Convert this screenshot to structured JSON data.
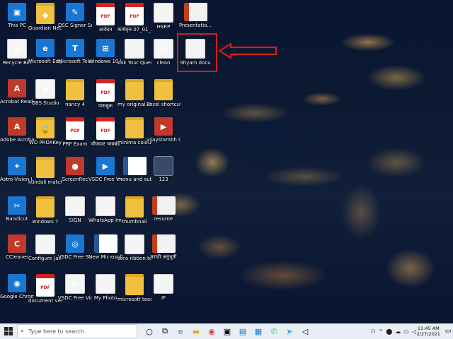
{
  "desktop": {
    "icons": [
      {
        "label": "This PC",
        "icon": "computer-icon",
        "style": "blue",
        "glyph": "▣"
      },
      {
        "label": "Guardian NetSecure",
        "icon": "guardian-shield-icon",
        "style": "folder",
        "glyph": "◆"
      },
      {
        "label": "DSC Signer Service",
        "icon": "dsc-signer-icon",
        "style": "blue",
        "glyph": "✎"
      },
      {
        "label": "आवेदन",
        "icon": "pdf-file-icon",
        "style": "pdf",
        "glyph": "PDF"
      },
      {
        "label": "कार्यवृत्त 07_01_2021",
        "icon": "pdf-file-icon",
        "style": "pdf",
        "glyph": "PDF"
      },
      {
        "label": "HSRP",
        "icon": "document-icon",
        "style": "doc",
        "glyph": ""
      },
      {
        "label": "Presentatio...",
        "icon": "powerpoint-file-icon",
        "style": "ppt",
        "glyph": ""
      },
      {
        "label": "Recycle Bin",
        "icon": "recycle-bin-icon",
        "style": "doc",
        "glyph": "♻"
      },
      {
        "label": "Microsoft Edge",
        "icon": "edge-browser-icon",
        "style": "blue",
        "glyph": "e"
      },
      {
        "label": "Microsoft Teams",
        "icon": "teams-icon",
        "style": "blue",
        "glyph": "T"
      },
      {
        "label": "Windows 10 Update As...",
        "icon": "windows-update-icon",
        "style": "blue",
        "glyph": "⊞"
      },
      {
        "label": "Ask Your Question",
        "icon": "document-icon",
        "style": "doc",
        "glyph": ""
      },
      {
        "label": "clean",
        "icon": "settings-file-icon",
        "style": "doc",
        "glyph": "⚙"
      },
      {
        "label": "Shyam docu",
        "icon": "word-file-icon",
        "style": "doc",
        "glyph": ""
      },
      {
        "label": "Acrobat Reader DC",
        "icon": "acrobat-icon",
        "style": "red",
        "glyph": "A"
      },
      {
        "label": "OBS Studio",
        "icon": "obs-studio-icon",
        "style": "doc",
        "glyph": "◉"
      },
      {
        "label": "nancy 4",
        "icon": "photo-file-icon",
        "style": "folder",
        "glyph": ""
      },
      {
        "label": "पासबुक",
        "icon": "pdf-file-icon",
        "style": "pdf",
        "glyph": "PDF"
      },
      {
        "label": "my original theme",
        "icon": "folder-icon",
        "style": "folder",
        "glyph": ""
      },
      {
        "label": "Excel shortcut...",
        "icon": "folder-icon",
        "style": "folder",
        "glyph": ""
      },
      {
        "label": "Adobe Acrobat DC",
        "icon": "acrobat-icon",
        "style": "red",
        "glyph": "A"
      },
      {
        "label": "WD PROXKey",
        "icon": "proxkey-lock-icon",
        "style": "folder",
        "glyph": "🔒"
      },
      {
        "label": "PRF Exam",
        "icon": "pdf-file-icon",
        "style": "pdf",
        "glyph": "PDF"
      },
      {
        "label": "मौजदार भावबंड",
        "icon": "pdf-file-icon",
        "style": "pdf",
        "glyph": "PDF"
      },
      {
        "label": "minima colour...",
        "icon": "folder-icon",
        "style": "folder",
        "glyph": ""
      },
      {
        "label": "vijaystambh GM 03",
        "icon": "video-file-icon",
        "style": "red",
        "glyph": "▶"
      },
      {
        "label": "Astro-Vision LifeSign M...",
        "icon": "astro-vision-icon",
        "style": "blue",
        "glyph": "✦"
      },
      {
        "label": "kundali matching",
        "icon": "folder-icon",
        "style": "folder",
        "glyph": ""
      },
      {
        "label": "ScreenRec",
        "icon": "screenrec-icon",
        "style": "red",
        "glyph": "●"
      },
      {
        "label": "VSDC Free Video E...",
        "icon": "vsdc-editor-icon",
        "style": "blue",
        "glyph": "▶"
      },
      {
        "label": "menu and sub menu",
        "icon": "word-file-icon",
        "style": "word",
        "glyph": ""
      },
      {
        "label": "123",
        "icon": "word-file-icon",
        "style": "sel",
        "glyph": ""
      },
      {
        "label": "Bandicut",
        "icon": "bandicut-icon",
        "style": "blue",
        "glyph": "✂"
      },
      {
        "label": "windows 7",
        "icon": "folder-icon",
        "style": "folder",
        "glyph": ""
      },
      {
        "label": "SIGN",
        "icon": "image-file-icon",
        "style": "doc",
        "glyph": ""
      },
      {
        "label": "WhatsApp Image 20...",
        "icon": "image-file-icon",
        "style": "doc",
        "glyph": ""
      },
      {
        "label": "thumbnail",
        "icon": "folder-icon",
        "style": "folder",
        "glyph": ""
      },
      {
        "label": "resume",
        "icon": "powerpoint-file-icon",
        "style": "ppt",
        "glyph": ""
      },
      {
        "label": "CCleaner",
        "icon": "ccleaner-icon",
        "style": "red",
        "glyph": "C"
      },
      {
        "label": "Configure Java",
        "icon": "document-icon",
        "style": "doc",
        "glyph": ""
      },
      {
        "label": "VSDC Free Screen R...",
        "icon": "vsdc-recorder-icon",
        "style": "blue",
        "glyph": "◎"
      },
      {
        "label": "New Microsoft...",
        "icon": "word-file-icon",
        "style": "word",
        "glyph": ""
      },
      {
        "label": "sora ribbon template",
        "icon": "document-icon",
        "style": "doc",
        "glyph": ""
      },
      {
        "label": "मराठी अनुभूती",
        "icon": "presentation-file-icon",
        "style": "ppt",
        "glyph": ""
      },
      {
        "label": "Google Chrome",
        "icon": "chrome-icon",
        "style": "blue",
        "glyph": "◉"
      },
      {
        "label": "document verification...",
        "icon": "pdf-file-icon",
        "style": "pdf",
        "glyph": "PDF"
      },
      {
        "label": "VSDC Free Video C...",
        "icon": "vsdc-converter-icon",
        "style": "doc",
        "glyph": "⟳"
      },
      {
        "label": "My Photo",
        "icon": "photo-file-icon",
        "style": "doc",
        "glyph": ""
      },
      {
        "label": "microsoft teams",
        "icon": "folder-icon",
        "style": "folder",
        "glyph": ""
      },
      {
        "label": "IF",
        "icon": "document-icon",
        "style": "doc",
        "glyph": ""
      }
    ]
  },
  "taskbar": {
    "search_placeholder": "Type here to search",
    "time": "11:45 AM",
    "date": "2/27/2021"
  }
}
